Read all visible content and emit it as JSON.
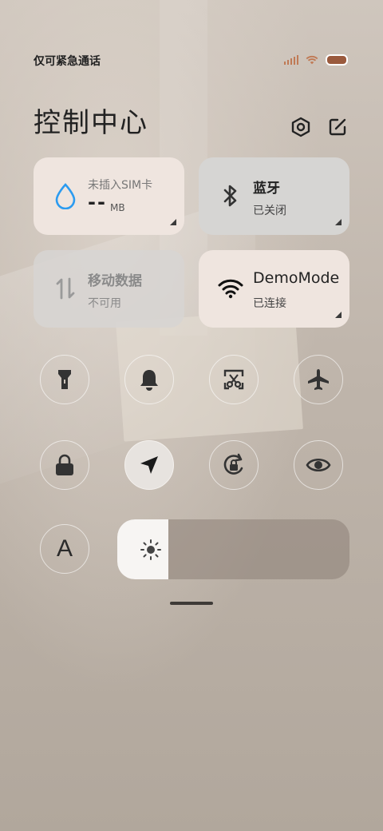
{
  "status_bar": {
    "carrier": "仅可紧急通话",
    "signal_level": 0.25,
    "battery_color": "#9a5a3d"
  },
  "header": {
    "title": "控制中心",
    "settings_icon": "hexagon-settings-icon",
    "edit_icon": "edit-icon"
  },
  "tiles": {
    "data_usage": {
      "icon": "water-drop-icon",
      "label": "未插入SIM卡",
      "value": "--",
      "unit": "MB"
    },
    "bluetooth": {
      "icon": "bluetooth-icon",
      "title": "蓝牙",
      "status": "已关闭"
    },
    "mobile_data": {
      "icon": "mobile-data-arrows-icon",
      "title": "移动数据",
      "status": "不可用"
    },
    "wifi": {
      "icon": "wifi-icon",
      "title": "DemoMode",
      "status": "已连接"
    }
  },
  "toggles": [
    {
      "name": "flashlight",
      "icon": "flashlight-icon",
      "active": false
    },
    {
      "name": "bell",
      "icon": "bell-icon",
      "active": false
    },
    {
      "name": "screenshot",
      "icon": "screenshot-scissors-icon",
      "active": false
    },
    {
      "name": "airplane",
      "icon": "airplane-icon",
      "active": false
    },
    {
      "name": "lock",
      "icon": "lock-icon",
      "active": false
    },
    {
      "name": "location",
      "icon": "location-arrow-icon",
      "active": true
    },
    {
      "name": "rotation-lock",
      "icon": "rotation-lock-icon",
      "active": false
    },
    {
      "name": "eye-comfort",
      "icon": "eye-icon",
      "active": false
    },
    {
      "name": "font",
      "icon": "font-a-icon",
      "label": "A",
      "active": false
    }
  ],
  "brightness": {
    "icon": "sun-icon",
    "level": 0.22
  },
  "colors": {
    "accent_blue": "#2b9bf0",
    "tile_light": "#efe5df",
    "tile_grey": "#d6d5d3"
  }
}
